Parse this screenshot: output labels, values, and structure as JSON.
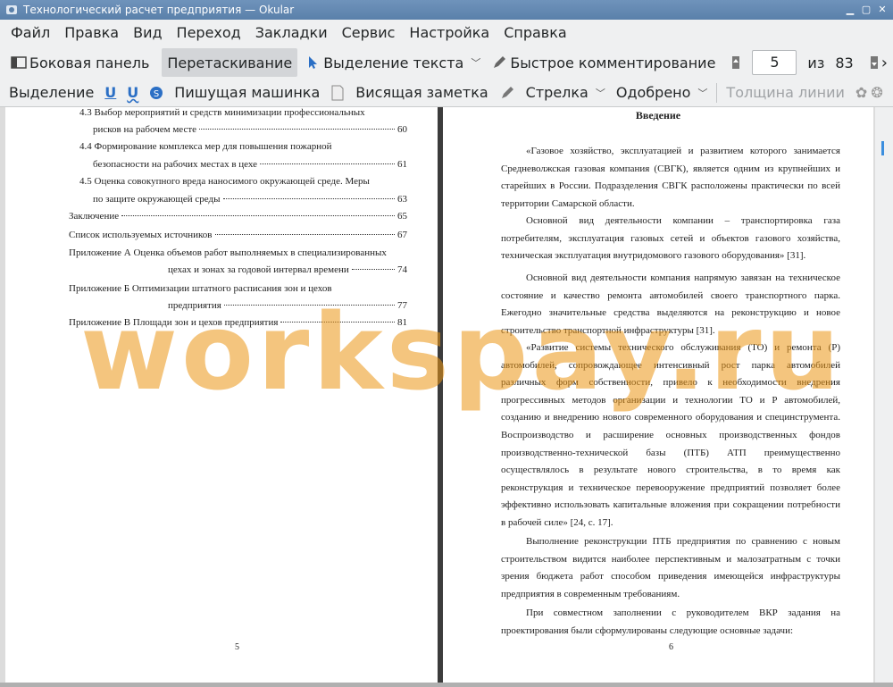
{
  "window": {
    "title": "Технологический расчет предприятия  — Okular"
  },
  "menu": [
    "Файл",
    "Правка",
    "Вид",
    "Переход",
    "Закладки",
    "Сервис",
    "Настройка",
    "Справка"
  ],
  "toolbar": {
    "sidebar": "Боковая панель",
    "drag": "Перетаскивание",
    "text_select": "Выделение текста",
    "quick_comment": "Быстрое комментирование",
    "page_current": "5",
    "page_of": "из",
    "page_total": "83"
  },
  "annot_toolbar": {
    "selection": "Выделение",
    "typewriter": "Пишущая машинка",
    "sticky_note": "Висящая заметка",
    "arrow": "Стрелка",
    "stamp": "Одобрено",
    "line_width": "Толщина линии"
  },
  "left_page": {
    "toc": [
      {
        "text": "4.3 Выбор мероприятий и средств минимизации профессиональных",
        "page": ""
      },
      {
        "text": "рисков на рабочем месте",
        "page": "60"
      },
      {
        "text": "4.4 Формирование комплекса мер для повышения пожарной",
        "page": ""
      },
      {
        "text": "безопасности на рабочих местах в цехе",
        "page": "61"
      },
      {
        "text": "4.5 Оценка совокупного вреда наносимого окружающей среде. Меры",
        "page": ""
      },
      {
        "text": "по защите окружающей среды",
        "page": "63"
      },
      {
        "text": "Заключение",
        "page": "65"
      },
      {
        "text": "Список используемых источников",
        "page": "67"
      },
      {
        "text": "Приложение А Оценка объемов работ выполняемых в специализированных",
        "page": ""
      },
      {
        "text": "цехах и зонах за годовой интервал времени",
        "page": "74"
      },
      {
        "text": "Приложение Б Оптимизации штатного расписания зон и цехов",
        "page": ""
      },
      {
        "text": "предприятия",
        "page": "77"
      },
      {
        "text": "Приложение В Площади зон и цехов предприятия",
        "page": "81"
      }
    ],
    "page_number": "5"
  },
  "right_page": {
    "heading": "Введение",
    "paragraphs": [
      "«Газовое хозяйство, эксплуатацией и развитием которого занимается Средневолжская газовая компания (СВГК), является одним из крупнейших и старейших в России. Подразделения СВГК расположены практически по всей территории Самарской области.",
      "Основной вид деятельности компании – транспортировка газа потребителям, эксплуатация газовых сетей и объектов газового хозяйства, техническая эксплуатация внутридомового газового оборудования» [31].",
      "Основной вид деятельности компания напрямую завязан на техническое состояние и качество ремонта автомобилей своего транспортного парка. Ежегодно значительные средства выделяются на реконструкцию и новое строительство транспортной инфраструктуры [31].",
      "«Развитие системы технического обслуживания (ТО) и ремонта (Р) автомобилей, сопровождающее интенсивный рост парка автомобилей различных форм собственности, привело к необходимости внедрения прогрессивных методов организации и технологии ТО и Р автомобилей, созданию и внедрению нового современного оборудования и специнструмента. Воспроизводство и расширение основных производственных фондов производственно-технической базы (ПТБ) АТП преимущественно осуществлялось в результате нового строительства, в то время как реконструкция и техническое перевооружение предприятий позволяет более эффективно использовать капитальные вложения при сокращении потребности в рабочей силе» [24, с. 17].",
      "Выполнение реконструкции ПТБ предприятия по сравнению с новым строительством видится наиболее перспективным и малозатратным с точки зрения бюджета работ способом приведения имеющейся инфраструктуры предприятия в современным требованиям.",
      "При совместном заполнении с руководителем ВКР задания на проектирования были сформулированы следующие основные задачи:"
    ],
    "page_number": "6"
  },
  "watermark": "workspay.ru",
  "colors": {
    "titlebar": "#5a80aa",
    "toolbar_bg": "#eff0f1",
    "watermark": "#eb9614",
    "scroll_handle": "#3b8ede"
  }
}
